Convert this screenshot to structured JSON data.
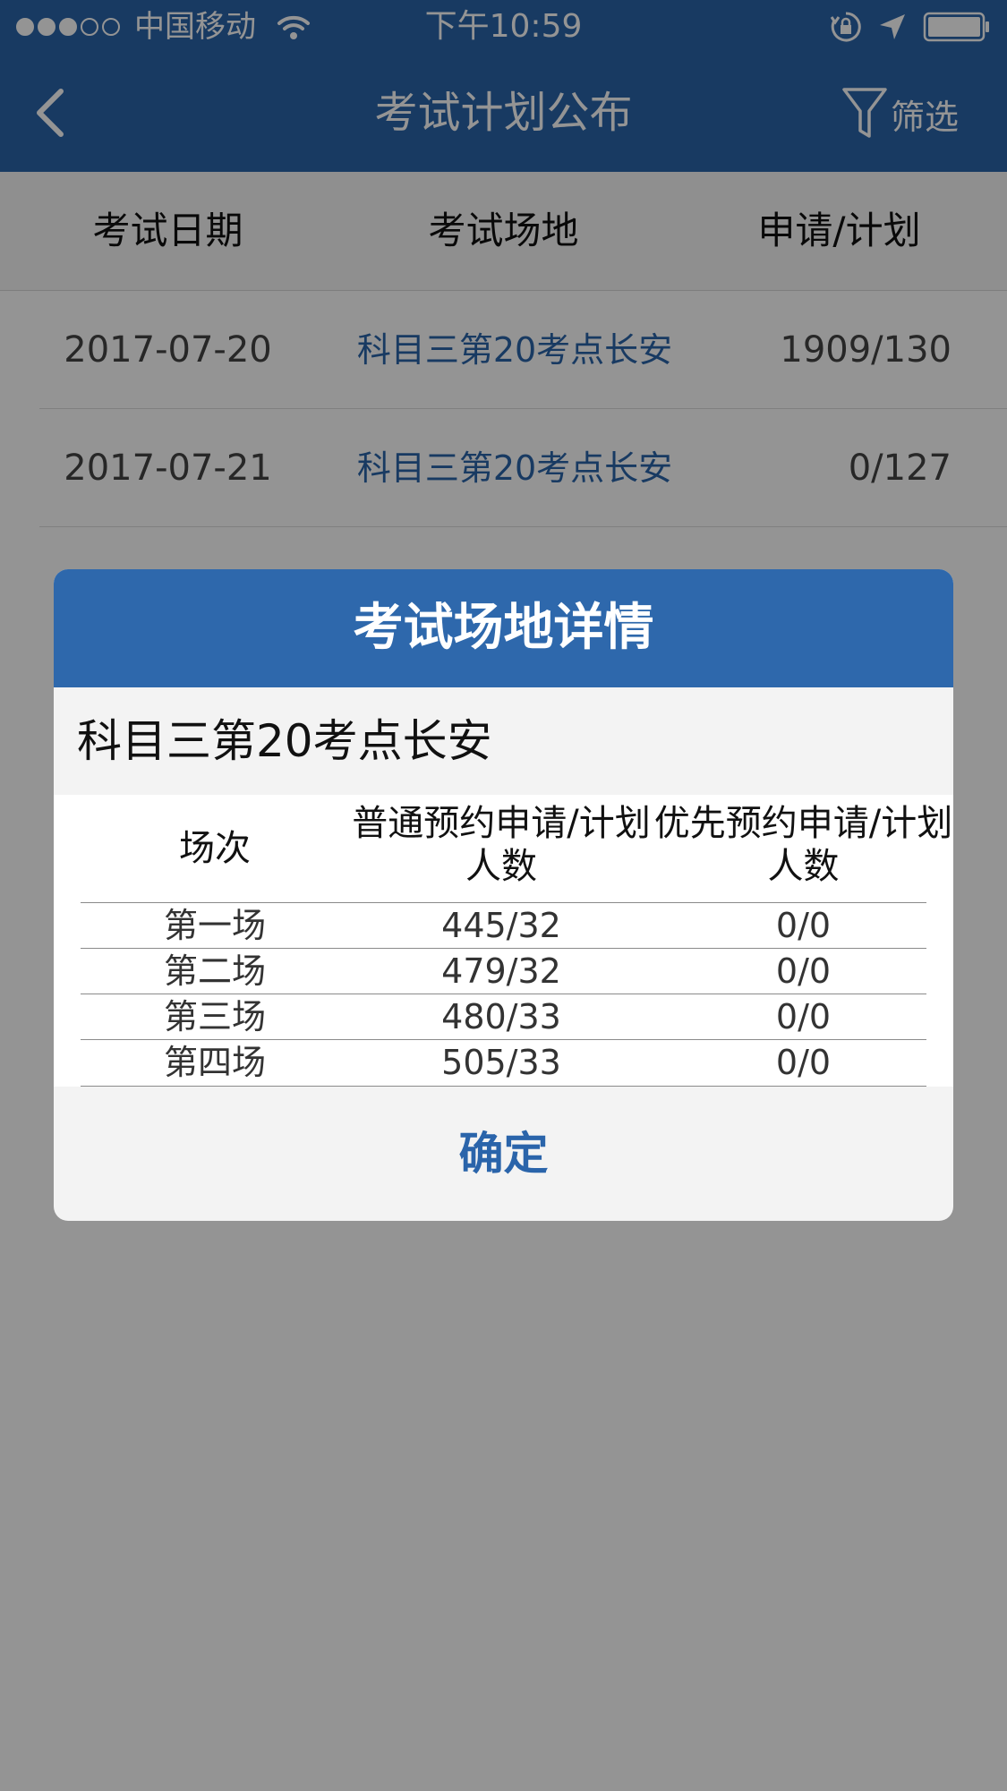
{
  "status_bar": {
    "carrier": "中国移动",
    "time": "下午10:59"
  },
  "nav": {
    "title": "考试计划公布",
    "filter_label": "筛选"
  },
  "table": {
    "headers": [
      "考试日期",
      "考试场地",
      "申请/计划"
    ],
    "rows": [
      {
        "date": "2017-07-20",
        "venue": "科目三第20考点长安",
        "ratio": "1909/130"
      },
      {
        "date": "2017-07-21",
        "venue": "科目三第20考点长安",
        "ratio": "0/127"
      }
    ]
  },
  "modal": {
    "title": "考试场地详情",
    "venue": "科目三第20考点长安",
    "columns": [
      "场次",
      "普通预约申请/计划人数",
      "优先预约申请/计划人数"
    ],
    "sessions": [
      {
        "name": "第一场",
        "normal": "445/32",
        "priority": "0/0"
      },
      {
        "name": "第二场",
        "normal": "479/32",
        "priority": "0/0"
      },
      {
        "name": "第三场",
        "normal": "480/33",
        "priority": "0/0"
      },
      {
        "name": "第四场",
        "normal": "505/33",
        "priority": "0/0"
      }
    ],
    "confirm_label": "确定"
  },
  "colors": {
    "nav_background": "#2a64aa",
    "modal_header": "#2e68ac",
    "link": "#2a64aa"
  }
}
